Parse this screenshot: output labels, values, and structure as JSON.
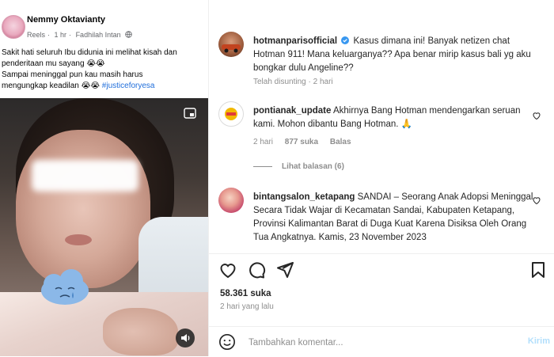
{
  "facebook_post": {
    "author": "Nemmy Oktavianty",
    "meta": {
      "type": "Reels",
      "separator": "·",
      "time": "1 hr",
      "separator2": "·",
      "tagged": "Fadhilah Intan"
    },
    "caption_line1": "Sakit hati seluruh Ibu didunia ini melihat kisah dan",
    "caption_line2": "penderitaan mu sayang",
    "caption_line3": "Sampai meninggal pun kau masih harus",
    "caption_line4": "mengungkap keadilan",
    "hashtag": "#justiceforyesa",
    "emoji": "😭😭"
  },
  "instagram": {
    "caption": {
      "username": "hotmanparisofficial",
      "text": "Kasus dimana ini! Banyak netizen chat Hotman 911! Mana keluarganya?? Apa benar mirip kasus bali yg aku bongkar dulu Angeline??",
      "meta": "Telah disunting · 2 hari"
    },
    "comments": [
      {
        "username": "pontianak_update",
        "text": "Akhirnya Bang Hotman mendengarkan seruan kami. Mohon dibantu Bang Hotman.",
        "emoji": "🙏",
        "time": "2 hari",
        "likes": "877 suka",
        "reply": "Balas",
        "view_replies": "Lihat balasan (6)"
      },
      {
        "username": "bintangsalon_ketapang",
        "text": "SANDAI – Seorang Anak Adopsi Meninggal Secara Tidak Wajar di Kecamatan Sandai, Kabupaten Ketapang, Provinsi Kalimantan Barat di Duga Kuat Karena Disiksa Oleh Orang Tua Angkatnya. Kamis, 23 November 2023"
      }
    ],
    "likes_count": "58.361 suka",
    "posted": "2 hari yang lalu",
    "composer": {
      "placeholder": "Tambahkan komentar...",
      "post_label": "Kirim"
    }
  }
}
